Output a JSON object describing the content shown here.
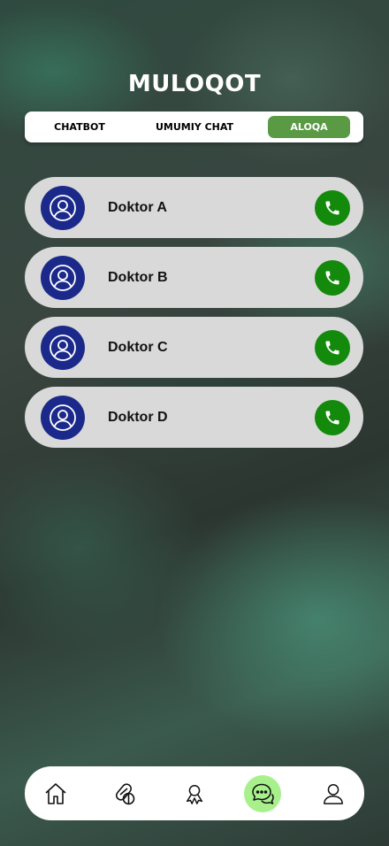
{
  "header": {
    "title": "MULOQOT"
  },
  "tabs": [
    {
      "label": "CHATBOT",
      "active": false
    },
    {
      "label": "UMUMIY CHAT",
      "active": false
    },
    {
      "label": "ALOQA",
      "active": true
    }
  ],
  "contacts": [
    {
      "name": "Doktor A",
      "avatar_icon": "user-circle-icon",
      "action_icon": "phone-icon"
    },
    {
      "name": "Doktor B",
      "avatar_icon": "user-circle-icon",
      "action_icon": "phone-icon"
    },
    {
      "name": "Doktor C",
      "avatar_icon": "user-circle-icon",
      "action_icon": "phone-icon"
    },
    {
      "name": "Doktor D",
      "avatar_icon": "user-circle-icon",
      "action_icon": "phone-icon"
    }
  ],
  "bottom_nav": [
    {
      "icon": "home-icon",
      "active": false
    },
    {
      "icon": "pills-icon",
      "active": false
    },
    {
      "icon": "award-icon",
      "active": false
    },
    {
      "icon": "chat-icon",
      "active": true
    },
    {
      "icon": "profile-icon",
      "active": false
    }
  ],
  "colors": {
    "active_tab": "#5a9a44",
    "avatar_bg": "#1b2a8a",
    "call_button": "#138a0b",
    "card_bg": "#d9d9d9",
    "active_nav": "#a8f08c"
  }
}
